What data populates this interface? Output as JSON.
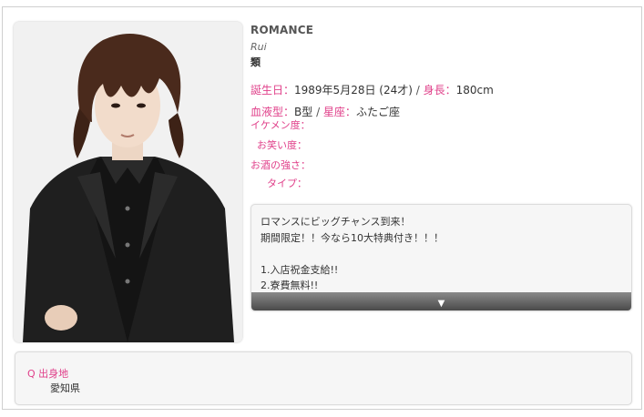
{
  "profile": {
    "shop": "ROMANCE",
    "name_romaji": "Rui",
    "name_kanji": "類",
    "birthday_label": "誕生日：",
    "birthday": "1989年5月28日 (24才)",
    "height_label": "身長：",
    "height": "180cm",
    "blood_label": "血液型：",
    "blood": "B型",
    "sign_label": "星座：",
    "sign": "ふたご座",
    "separator": " / ",
    "params": [
      {
        "label": "イケメン度："
      },
      {
        "label": "お笑い度："
      },
      {
        "label": "お酒の強さ："
      },
      {
        "label": "タイプ："
      }
    ]
  },
  "message": {
    "lines": [
      "ロマンスにビッグチャンス到来！",
      "期間限定！！今なら10大特典付き！！！",
      "",
      "1.入店祝金支給!!",
      "2.寮費無料!!"
    ],
    "expand_glyph": "▼"
  },
  "qa": {
    "question": "Q 出身地",
    "answer": "愛知県"
  }
}
